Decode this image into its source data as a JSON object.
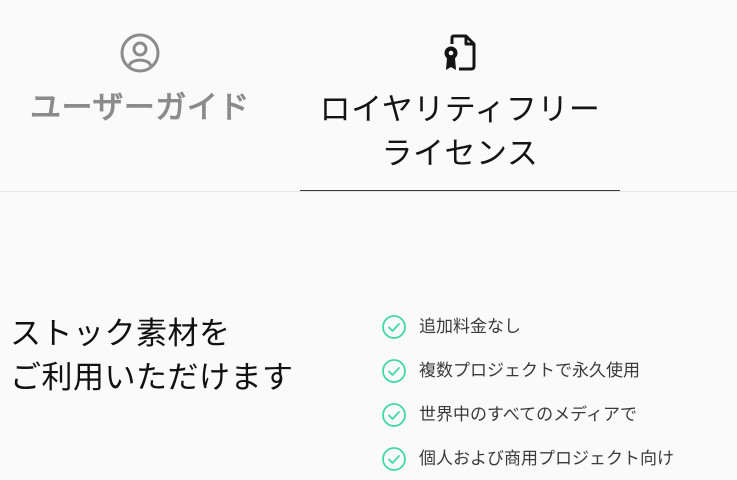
{
  "tabs": [
    {
      "label": "ユーザーガイド",
      "icon": "user-circle-icon",
      "active": false
    },
    {
      "label_lines": [
        "ロイヤリティフリー",
        "ライセンス"
      ],
      "icon": "certificate-document-icon",
      "active": true
    }
  ],
  "heading": {
    "lines": [
      "ストック素材を",
      "ご利用いただけます"
    ]
  },
  "features": [
    {
      "text": "追加料金なし",
      "icon": "check-circle-icon"
    },
    {
      "text": "複数プロジェクトで永久使用",
      "icon": "check-circle-icon"
    },
    {
      "text": "世界中のすべてのメディアで",
      "icon": "check-circle-icon"
    },
    {
      "text": "個人および商用プロジェクト向け",
      "icon": "check-circle-icon"
    }
  ],
  "colors": {
    "background": "#fafafa",
    "inactive_tab": "#8b8b8b",
    "active_tab": "#141414",
    "check": "#3fd9a5",
    "feature_text": "#3a3a3a"
  }
}
